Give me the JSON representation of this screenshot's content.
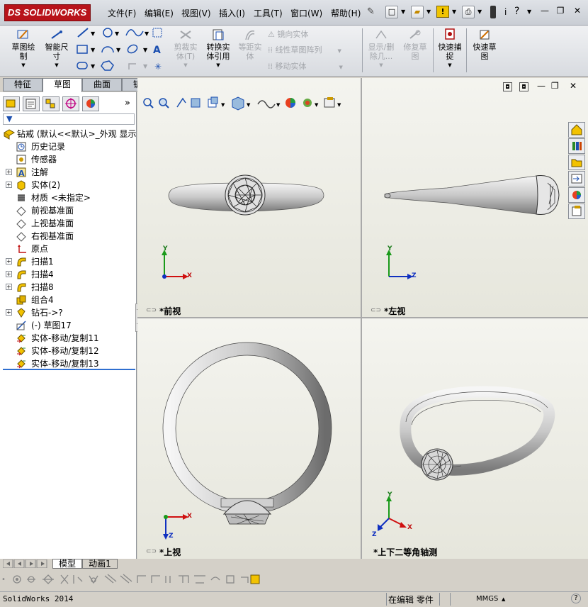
{
  "app": {
    "logo": "SOLIDWORKS",
    "logo_prefix": "DS"
  },
  "menu": [
    "文件(F)",
    "编辑(E)",
    "视图(V)",
    "插入(I)",
    "工具(T)",
    "窗口(W)",
    "帮助(H)"
  ],
  "commands": {
    "sketch": "草图绘\n制",
    "smart_dim": "智能尺\n寸",
    "trim": "剪裁实\n体(T)",
    "convert": "转换实\n体引用",
    "offset": "等距实\n体",
    "mirror": "镜向实体",
    "linear_pattern": "线性草图阵列",
    "move": "移动实体",
    "show_delete": "显示/删\n除几...",
    "repair": "修复草\n图",
    "quick_snap": "快速捕\n捉",
    "rapid_sketch": "快速草\n图"
  },
  "tabs": [
    "特征",
    "草图",
    "曲面",
    "钣金"
  ],
  "tree": {
    "root": "钻戒  (默认<<默认>_外观 显示",
    "items": [
      {
        "label": "历史记录",
        "expand": false
      },
      {
        "label": "传感器",
        "expand": false
      },
      {
        "label": "注解",
        "expand": true
      },
      {
        "label": "实体(2)",
        "expand": true
      },
      {
        "label": "材质 <未指定>",
        "expand": false
      },
      {
        "label": "前视基准面",
        "expand": false
      },
      {
        "label": "上视基准面",
        "expand": false
      },
      {
        "label": "右视基准面",
        "expand": false
      },
      {
        "label": "原点",
        "expand": false
      },
      {
        "label": "扫描1",
        "expand": true
      },
      {
        "label": "扫描4",
        "expand": true
      },
      {
        "label": "扫描8",
        "expand": true
      },
      {
        "label": "组合4",
        "expand": false
      },
      {
        "label": "钻石->?",
        "expand": true
      },
      {
        "label": "(-) 草图17",
        "expand": false
      },
      {
        "label": "实体-移动/复制11",
        "expand": false
      },
      {
        "label": "实体-移动/复制12",
        "expand": false
      },
      {
        "label": "实体-移动/复制13",
        "expand": false
      }
    ]
  },
  "viewports": {
    "front": "*前视",
    "left": "*左视",
    "top": "*上视",
    "iso": "*上下二等角轴测"
  },
  "axes": {
    "x": "X",
    "y": "Y",
    "z": "Z"
  },
  "bottom_tabs": [
    "模型",
    "动画1"
  ],
  "status": {
    "app": "SolidWorks 2014",
    "mode": "在编辑 零件",
    "units": "MMGS",
    "help": "?"
  },
  "colors": {
    "ring": "#cfcfcf",
    "accent": "#2f6fd0"
  }
}
